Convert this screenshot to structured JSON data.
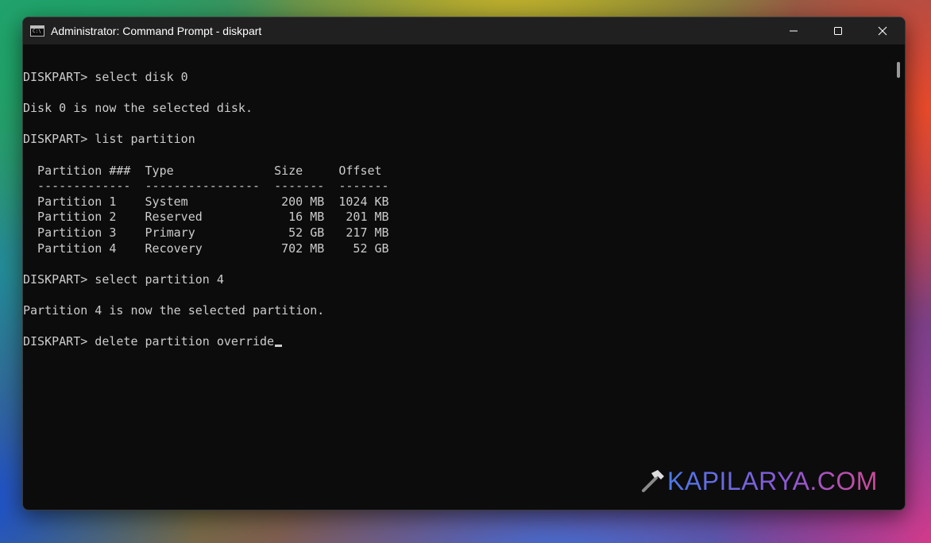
{
  "window": {
    "title": "Administrator: Command Prompt - diskpart",
    "app_icon_text": "C:\\"
  },
  "console": {
    "lines": [
      "DISKPART> select disk 0",
      "",
      "Disk 0 is now the selected disk.",
      "",
      "DISKPART> list partition",
      "",
      "  Partition ###  Type              Size     Offset",
      "  -------------  ----------------  -------  -------",
      "  Partition 1    System             200 MB  1024 KB",
      "  Partition 2    Reserved            16 MB   201 MB",
      "  Partition 3    Primary             52 GB   217 MB",
      "  Partition 4    Recovery           702 MB    52 GB",
      "",
      "DISKPART> select partition 4",
      "",
      "Partition 4 is now the selected partition.",
      "",
      "DISKPART> delete partition override"
    ]
  },
  "watermark": {
    "text": "KAPILARYA.COM"
  },
  "icons": {
    "minimize": "minimize-icon",
    "maximize": "maximize-icon",
    "close": "close-icon",
    "watermark": "hammer-icon"
  }
}
